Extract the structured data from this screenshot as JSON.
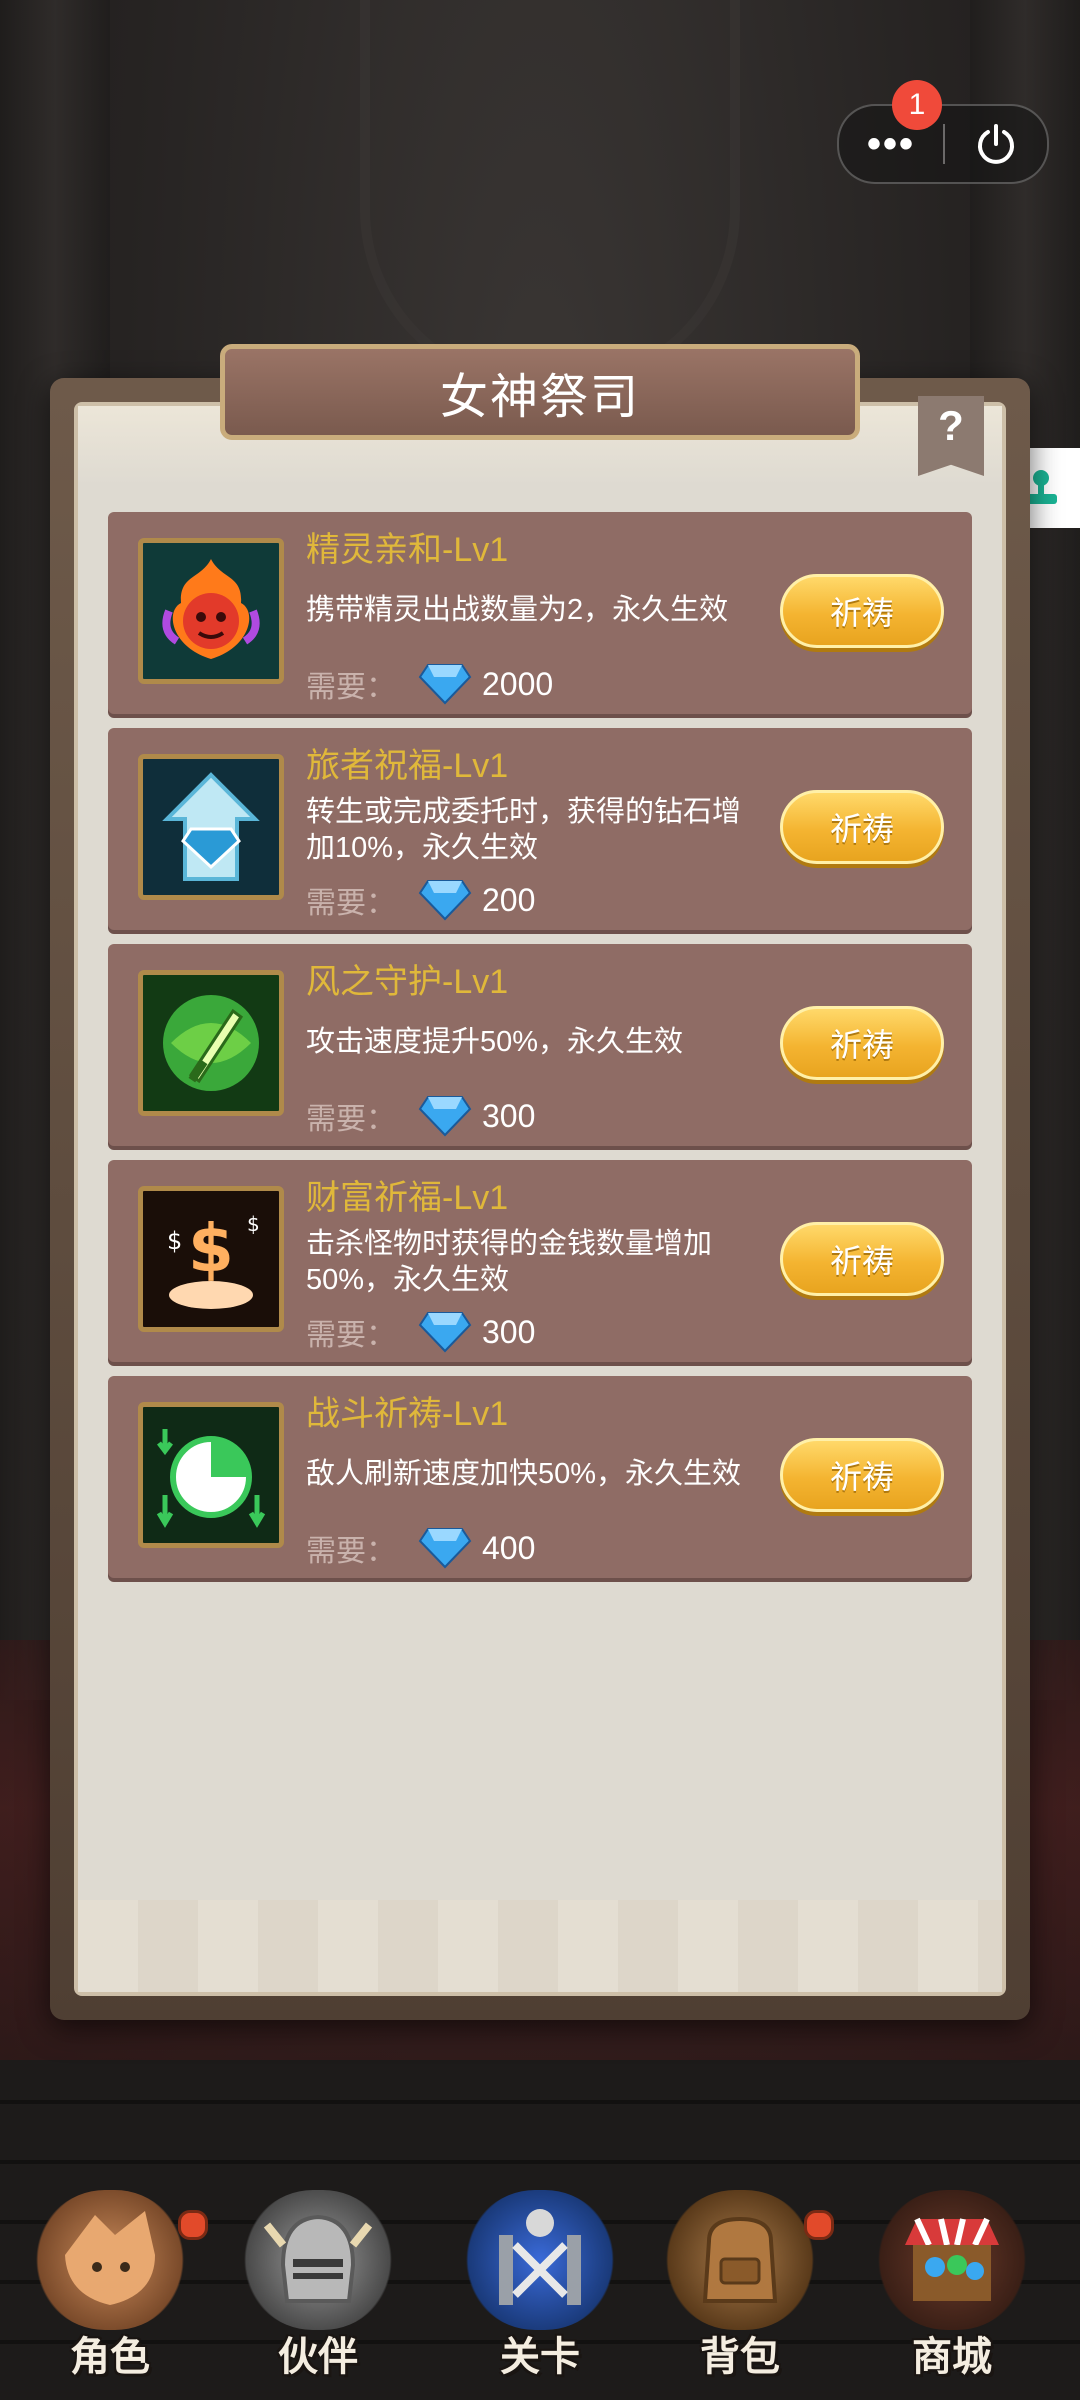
{
  "capsule": {
    "badge_count": "1",
    "more_icon": "more-dots-icon",
    "power_icon": "power-icon"
  },
  "side_button": {
    "icon": "joystick-icon"
  },
  "panel": {
    "title": "女神祭司",
    "help_symbol": "?"
  },
  "skills": [
    {
      "name": "精灵亲和-Lv1",
      "desc": "携带精灵出战数量为2，永久生效",
      "req_label": "需要：",
      "cost": "2000",
      "button": "祈祷",
      "icon": "fire-spirit-icon"
    },
    {
      "name": "旅者祝福-Lv1",
      "desc": "转生或完成委托时，获得的钻石增加10%，永久生效",
      "req_label": "需要：",
      "cost": "200",
      "button": "祈祷",
      "icon": "diamond-arrow-icon"
    },
    {
      "name": "风之守护-Lv1",
      "desc": "攻击速度提升50%，永久生效",
      "req_label": "需要：",
      "cost": "300",
      "button": "祈祷",
      "icon": "wind-sword-icon"
    },
    {
      "name": "财富祈福-Lv1",
      "desc": "击杀怪物时获得的金钱数量增加50%，永久生效",
      "req_label": "需要：",
      "cost": "300",
      "button": "祈祷",
      "icon": "money-cloud-icon"
    },
    {
      "name": "战斗祈祷-Lv1",
      "desc": "敌人刷新速度加快50%，永久生效",
      "req_label": "需要：",
      "cost": "400",
      "button": "祈祷",
      "icon": "clock-arrows-icon"
    }
  ],
  "nav": [
    {
      "label": "角色",
      "icon": "hero-portrait-icon",
      "has_dot": true
    },
    {
      "label": "伙伴",
      "icon": "knight-helmet-icon",
      "has_dot": false
    },
    {
      "label": "关卡",
      "icon": "stage-swords-icon",
      "has_dot": false
    },
    {
      "label": "背包",
      "icon": "backpack-icon",
      "has_dot": true
    },
    {
      "label": "商城",
      "icon": "shop-stall-icon",
      "has_dot": false
    }
  ],
  "colors": {
    "skill_name": "#e0b83a",
    "button": "#f4b431",
    "badge": "#f04a3a",
    "gem": "#3aa8f0"
  }
}
